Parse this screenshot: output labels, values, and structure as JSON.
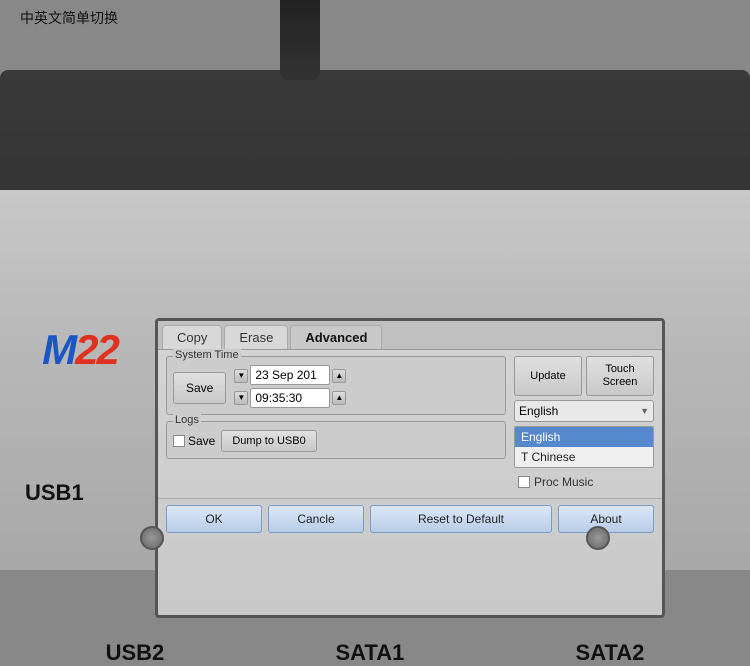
{
  "annotation": "中英文简单切换",
  "logo": {
    "m": "M",
    "numbers": "22"
  },
  "tabs": [
    {
      "label": "Copy",
      "active": false
    },
    {
      "label": "Erase",
      "active": false
    },
    {
      "label": "Advanced",
      "active": true
    }
  ],
  "system_time": {
    "group_label": "System Time",
    "save_label": "Save",
    "date_value": "23 Sep 201",
    "time_value": "09:35:30"
  },
  "logs": {
    "group_label": "Logs",
    "save_label": "Save",
    "dump_label": "Dump to USB0"
  },
  "right_panel": {
    "update_label": "Update",
    "touch_screen_label": "Touch\nScreen",
    "language_selected": "English",
    "dropdown_items": [
      {
        "label": "English",
        "selected": true
      },
      {
        "label": "T Chinese",
        "selected": false
      }
    ],
    "proc_music_label": "Proc Music"
  },
  "action_bar": {
    "ok_label": "OK",
    "cancel_label": "Cancle",
    "reset_label": "Reset to Default",
    "about_label": "About"
  },
  "side_labels": {
    "usb1": "USB1",
    "usb2": "USB2",
    "sata1": "SATA1",
    "sata2": "SATA2"
  }
}
